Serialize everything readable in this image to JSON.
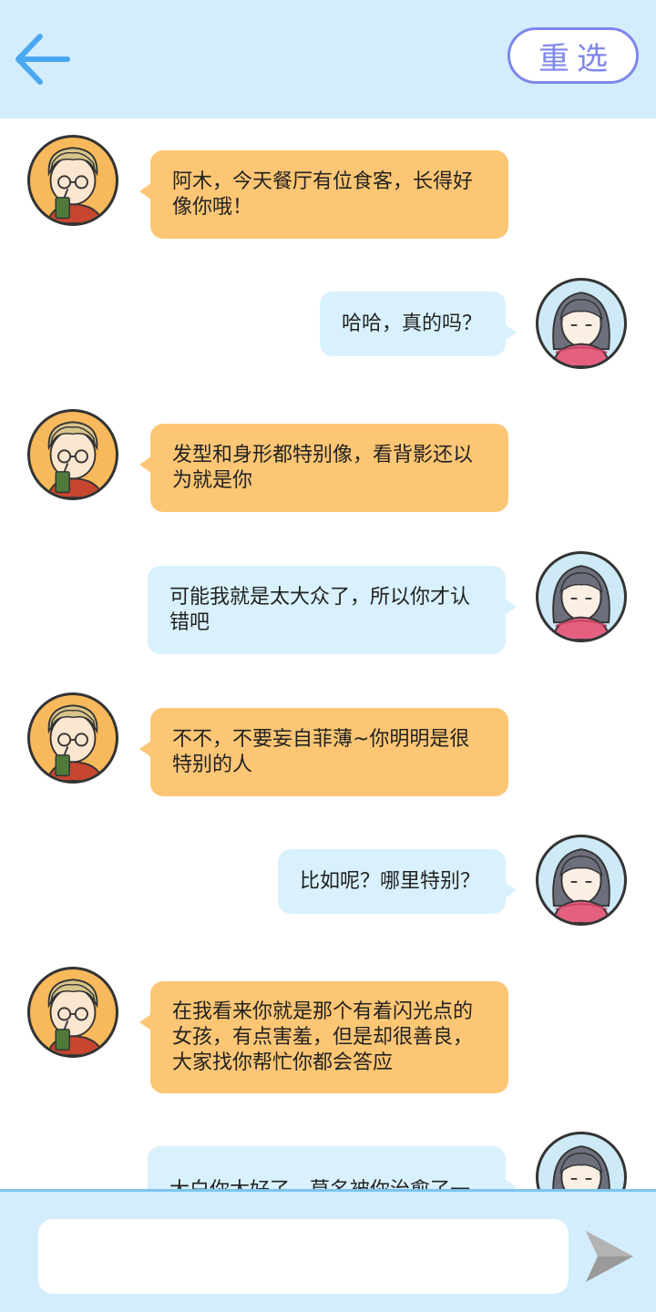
{
  "header": {
    "back_icon": "arrow-left-icon",
    "reselect_label": "重选",
    "accent_color": "#7f86ec"
  },
  "messages": [
    {
      "sender": "boy",
      "text": "阿木，今天餐厅有位食客，长得好像你哦！"
    },
    {
      "sender": "girl",
      "text": "哈哈，真的吗？"
    },
    {
      "sender": "boy",
      "text": "发型和身形都特别像，看背影还以为就是你"
    },
    {
      "sender": "girl",
      "text": "可能我就是太大众了，所以你才认错吧"
    },
    {
      "sender": "boy",
      "text": "不不，不要妄自菲薄~你明明是很特别的人"
    },
    {
      "sender": "girl",
      "text": "比如呢？哪里特别？"
    },
    {
      "sender": "boy",
      "text": "在我看来你就是那个有着闪光点的女孩，有点害羞，但是却很善良，大家找你帮忙你都会答应"
    },
    {
      "sender": "girl",
      "text": "大白你太好了，莫名被你治愈了一"
    }
  ],
  "footer": {
    "input_value": "",
    "send_icon": "send-arrow-icon"
  },
  "colors": {
    "header_bg": "#d4edfc",
    "boy_bubble": "#fdc674",
    "girl_bubble": "#d8f1fc"
  }
}
